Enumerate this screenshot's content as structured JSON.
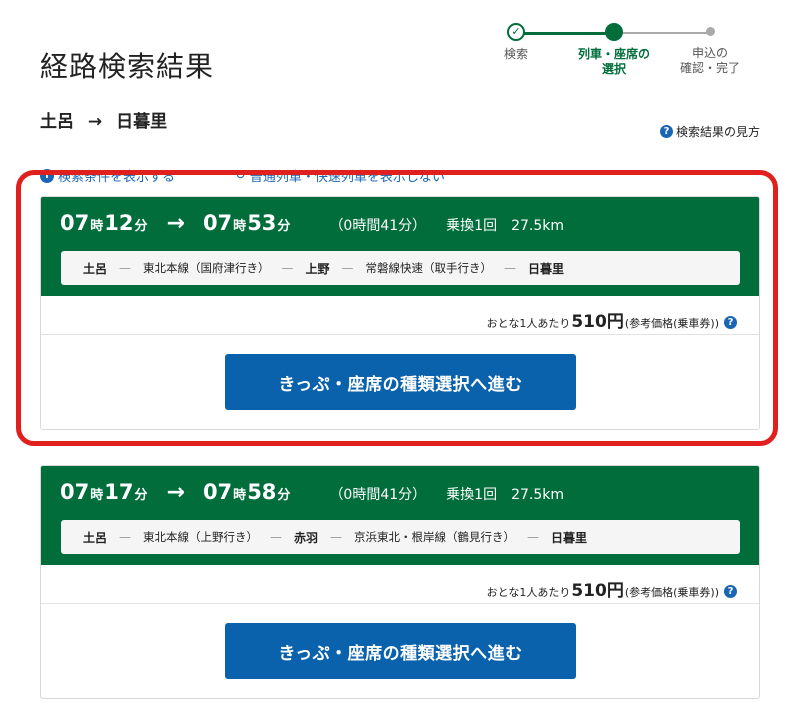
{
  "page": {
    "title": "経路検索結果"
  },
  "route": {
    "from": "土呂",
    "arrow": "→",
    "to": "日暮里"
  },
  "stepper": {
    "steps": [
      {
        "icon": "check-icon",
        "label": "検索"
      },
      {
        "label_line1": "列車・座席の",
        "label_line2": "選択"
      },
      {
        "label_line1": "申込の",
        "label_line2": "確認・完了"
      }
    ]
  },
  "help": {
    "icon": "question-icon",
    "label": "検索結果の見方"
  },
  "options": {
    "show_conditions": "検索条件を表示する",
    "hide_local": "普通列車・快速列車を表示しない"
  },
  "results": [
    {
      "dep_h": "07",
      "dep_m": "12",
      "arr_h": "07",
      "arr_m": "53",
      "hour_unit": "時",
      "min_unit": "分",
      "arrow": "→",
      "duration": "（0時間41分）",
      "transfers": "乗換1回",
      "distance": "27.5km",
      "path": {
        "s1": "土呂",
        "l1": "東北本線（国府津行き）",
        "s2": "上野",
        "l2": "常磐線快速（取手行き）",
        "s3": "日暮里"
      },
      "fare": {
        "prefix": "おとな1人あたり",
        "price": "510円",
        "suffix": "(参考価格(乗車券))"
      },
      "cta": "きっぷ・座席の種類選択へ進む"
    },
    {
      "dep_h": "07",
      "dep_m": "17",
      "arr_h": "07",
      "arr_m": "58",
      "hour_unit": "時",
      "min_unit": "分",
      "arrow": "→",
      "duration": "（0時間41分）",
      "transfers": "乗換1回",
      "distance": "27.5km",
      "path": {
        "s1": "土呂",
        "l1": "東北本線（上野行き）",
        "s2": "赤羽",
        "l2": "京浜東北・根岸線（鶴見行き）",
        "s3": "日暮里"
      },
      "fare": {
        "prefix": "おとな1人あたり",
        "price": "510円",
        "suffix": "(参考価格(乗車券))"
      },
      "cta": "きっぷ・座席の種類選択へ進む"
    }
  ],
  "colors": {
    "brand_green": "#006d3b",
    "button_blue": "#0a62ac",
    "highlight_red": "#e0201e"
  }
}
